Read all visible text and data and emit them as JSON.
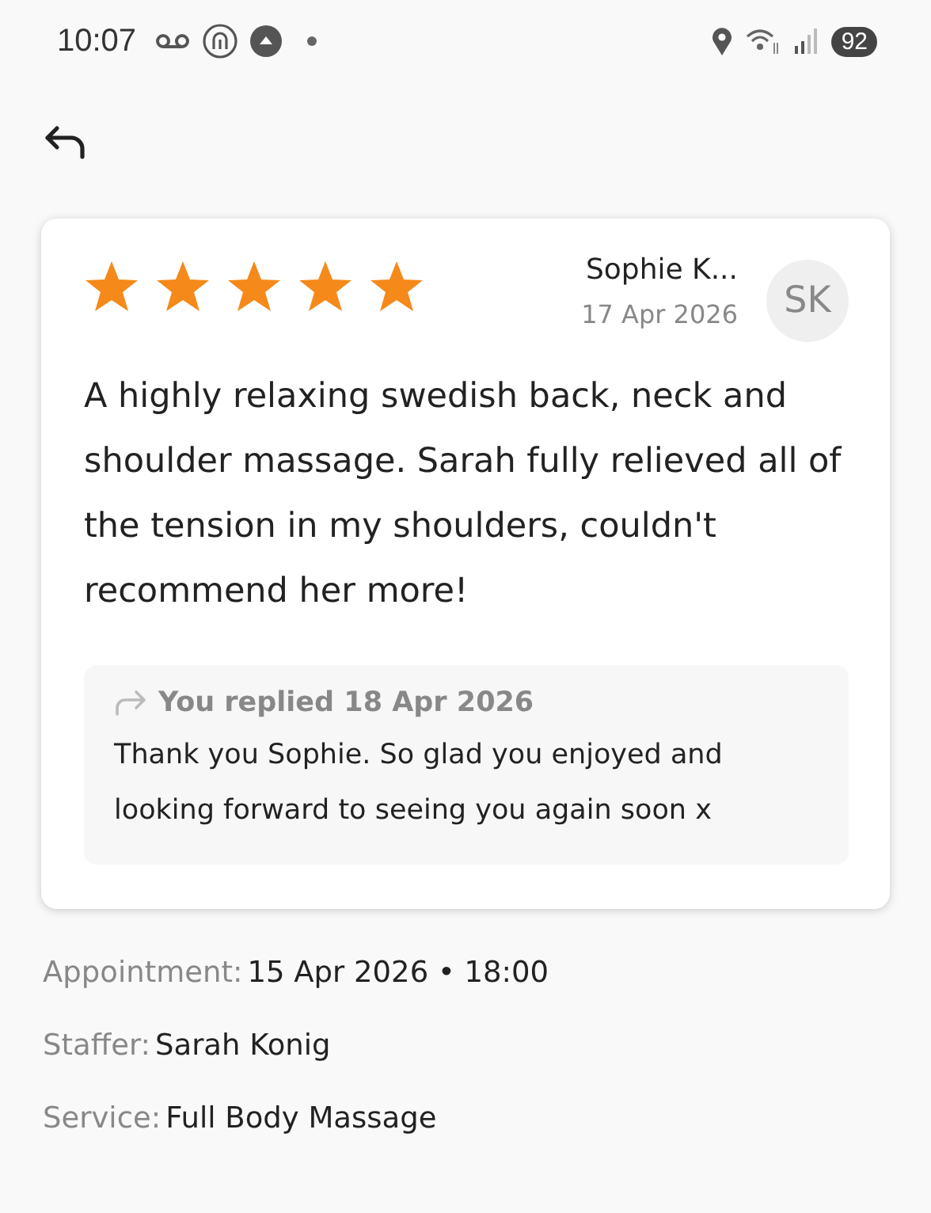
{
  "status_bar": {
    "time": "10:07",
    "battery": "92"
  },
  "review": {
    "stars": 5,
    "reviewer": "Sophie K...",
    "date": "17 Apr 2026",
    "initials": "SK",
    "text": "A highly relaxing swedish back, neck and shoulder massage. Sarah fully relieved all of the tension in my shoulders, couldn't recommend her more!",
    "reply": {
      "heading": "You replied 18 Apr 2026",
      "text": "Thank you Sophie. So glad you enjoyed and looking forward to seeing you again soon x"
    }
  },
  "details": [
    {
      "label": "Appointment:",
      "value": "15 Apr 2026 • 18:00"
    },
    {
      "label": "Staffer:",
      "value": "Sarah Konig"
    },
    {
      "label": "Service:",
      "value": "Full Body Massage"
    }
  ]
}
